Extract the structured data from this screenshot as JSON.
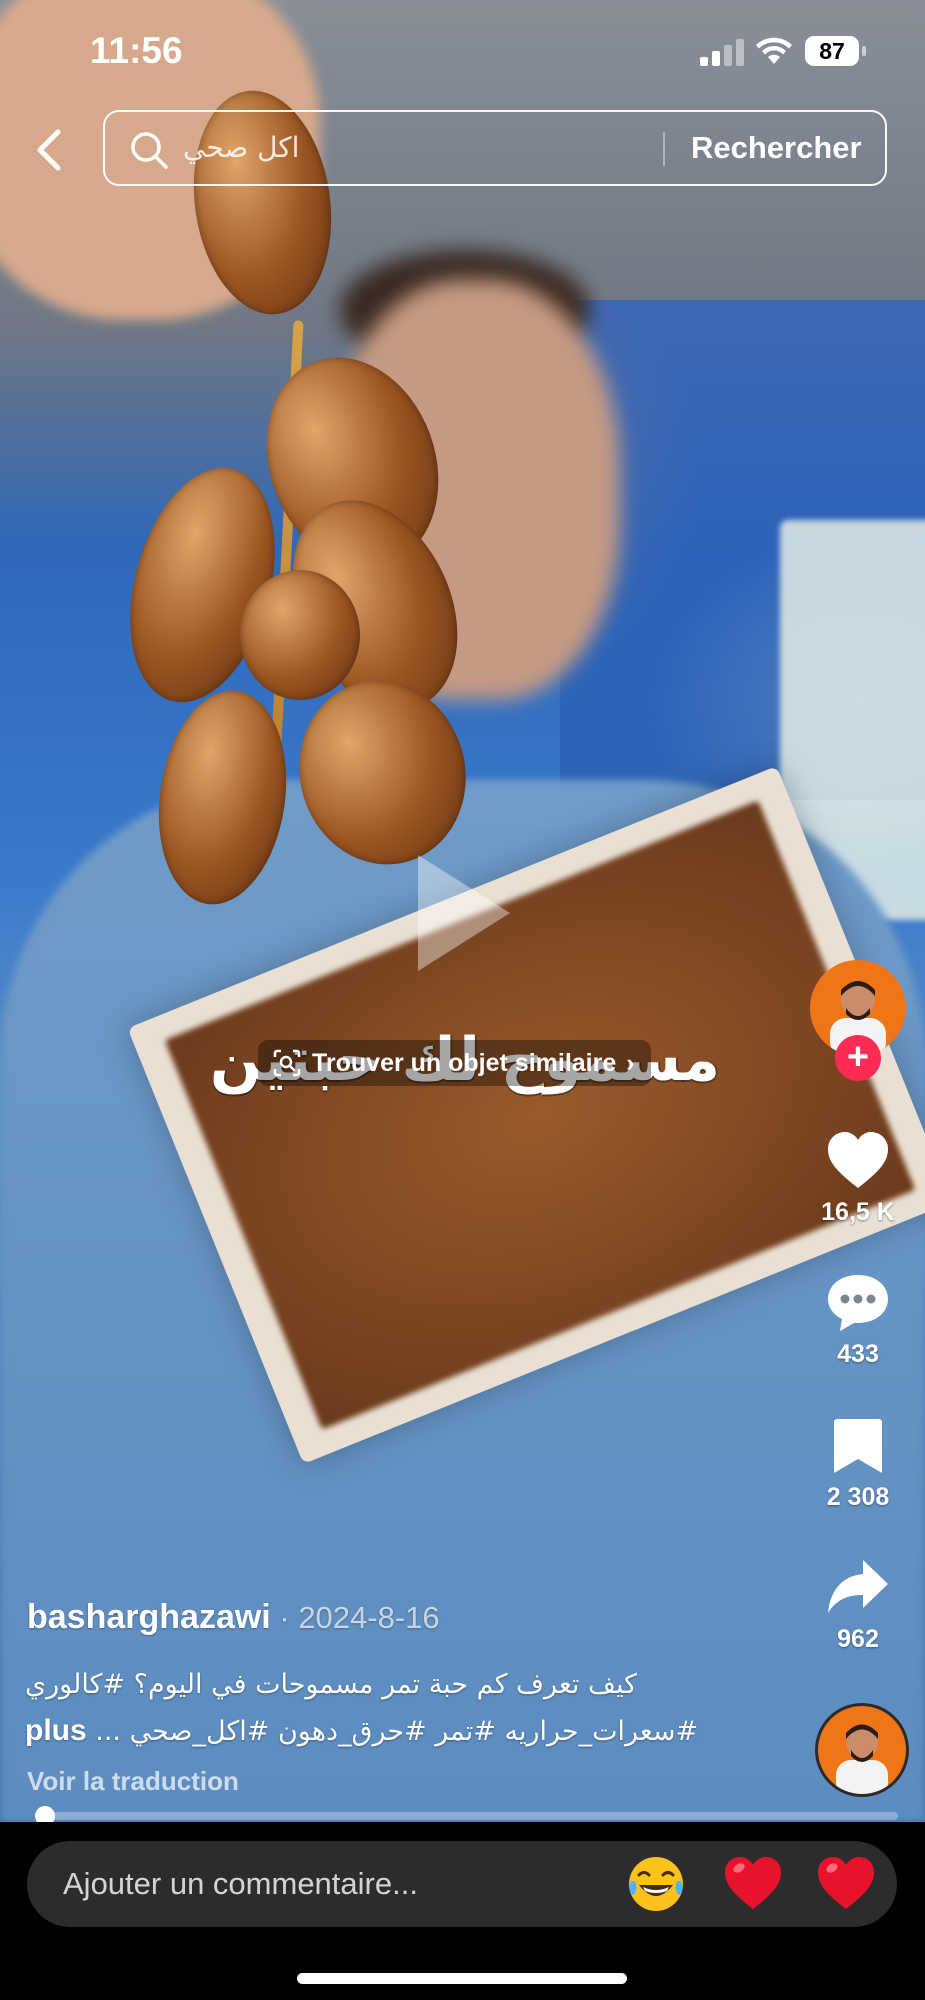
{
  "status_bar": {
    "time": "11:56",
    "battery": "87"
  },
  "search": {
    "query": "اكل صحي",
    "button_label": "Rechercher"
  },
  "video": {
    "overlay_text": "مسموح لك حبتين",
    "find_similar_label": "Trouver un objet similaire",
    "find_similar_chevron": "›"
  },
  "actions": {
    "likes": "16,5 K",
    "comments": "433",
    "saves": "2 308",
    "shares": "962"
  },
  "post": {
    "username": "basharghazawi",
    "date_separator": " · ",
    "date": "2024-8-16",
    "caption_line1": "كيف تعرف كم حبة تمر مسموحات في اليوم؟ #كالوري",
    "caption_line2": "#سعرات_حراريه #تمر #حرق_دهون #اكل_صحي ...",
    "more_label": "plus",
    "see_translation": "Voir la traduction"
  },
  "progress": {
    "fraction": 0.01
  },
  "comment_bar": {
    "placeholder": "Ajouter un commentaire...",
    "emojis": [
      "tears-of-joy-emoji",
      "red-heart-emoji",
      "red-heart-emoji"
    ]
  },
  "colors": {
    "follow": "#fe2c55",
    "avatar_bg": "#f07418",
    "comment_box": "#2c2c2e"
  }
}
